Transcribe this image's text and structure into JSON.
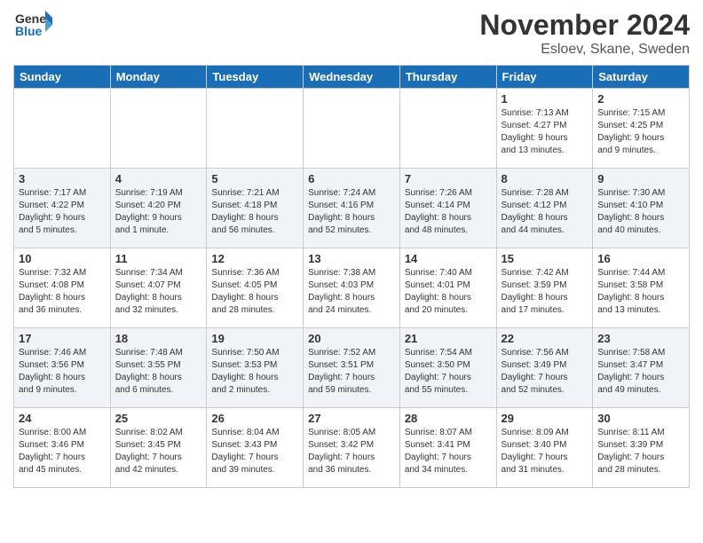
{
  "header": {
    "logo_general": "General",
    "logo_blue": "Blue",
    "month_title": "November 2024",
    "location": "Esloev, Skane, Sweden"
  },
  "weekdays": [
    "Sunday",
    "Monday",
    "Tuesday",
    "Wednesday",
    "Thursday",
    "Friday",
    "Saturday"
  ],
  "weeks": [
    [
      {
        "day": "",
        "info": ""
      },
      {
        "day": "",
        "info": ""
      },
      {
        "day": "",
        "info": ""
      },
      {
        "day": "",
        "info": ""
      },
      {
        "day": "",
        "info": ""
      },
      {
        "day": "1",
        "info": "Sunrise: 7:13 AM\nSunset: 4:27 PM\nDaylight: 9 hours\nand 13 minutes."
      },
      {
        "day": "2",
        "info": "Sunrise: 7:15 AM\nSunset: 4:25 PM\nDaylight: 9 hours\nand 9 minutes."
      }
    ],
    [
      {
        "day": "3",
        "info": "Sunrise: 7:17 AM\nSunset: 4:22 PM\nDaylight: 9 hours\nand 5 minutes."
      },
      {
        "day": "4",
        "info": "Sunrise: 7:19 AM\nSunset: 4:20 PM\nDaylight: 9 hours\nand 1 minute."
      },
      {
        "day": "5",
        "info": "Sunrise: 7:21 AM\nSunset: 4:18 PM\nDaylight: 8 hours\nand 56 minutes."
      },
      {
        "day": "6",
        "info": "Sunrise: 7:24 AM\nSunset: 4:16 PM\nDaylight: 8 hours\nand 52 minutes."
      },
      {
        "day": "7",
        "info": "Sunrise: 7:26 AM\nSunset: 4:14 PM\nDaylight: 8 hours\nand 48 minutes."
      },
      {
        "day": "8",
        "info": "Sunrise: 7:28 AM\nSunset: 4:12 PM\nDaylight: 8 hours\nand 44 minutes."
      },
      {
        "day": "9",
        "info": "Sunrise: 7:30 AM\nSunset: 4:10 PM\nDaylight: 8 hours\nand 40 minutes."
      }
    ],
    [
      {
        "day": "10",
        "info": "Sunrise: 7:32 AM\nSunset: 4:08 PM\nDaylight: 8 hours\nand 36 minutes."
      },
      {
        "day": "11",
        "info": "Sunrise: 7:34 AM\nSunset: 4:07 PM\nDaylight: 8 hours\nand 32 minutes."
      },
      {
        "day": "12",
        "info": "Sunrise: 7:36 AM\nSunset: 4:05 PM\nDaylight: 8 hours\nand 28 minutes."
      },
      {
        "day": "13",
        "info": "Sunrise: 7:38 AM\nSunset: 4:03 PM\nDaylight: 8 hours\nand 24 minutes."
      },
      {
        "day": "14",
        "info": "Sunrise: 7:40 AM\nSunset: 4:01 PM\nDaylight: 8 hours\nand 20 minutes."
      },
      {
        "day": "15",
        "info": "Sunrise: 7:42 AM\nSunset: 3:59 PM\nDaylight: 8 hours\nand 17 minutes."
      },
      {
        "day": "16",
        "info": "Sunrise: 7:44 AM\nSunset: 3:58 PM\nDaylight: 8 hours\nand 13 minutes."
      }
    ],
    [
      {
        "day": "17",
        "info": "Sunrise: 7:46 AM\nSunset: 3:56 PM\nDaylight: 8 hours\nand 9 minutes."
      },
      {
        "day": "18",
        "info": "Sunrise: 7:48 AM\nSunset: 3:55 PM\nDaylight: 8 hours\nand 6 minutes."
      },
      {
        "day": "19",
        "info": "Sunrise: 7:50 AM\nSunset: 3:53 PM\nDaylight: 8 hours\nand 2 minutes."
      },
      {
        "day": "20",
        "info": "Sunrise: 7:52 AM\nSunset: 3:51 PM\nDaylight: 7 hours\nand 59 minutes."
      },
      {
        "day": "21",
        "info": "Sunrise: 7:54 AM\nSunset: 3:50 PM\nDaylight: 7 hours\nand 55 minutes."
      },
      {
        "day": "22",
        "info": "Sunrise: 7:56 AM\nSunset: 3:49 PM\nDaylight: 7 hours\nand 52 minutes."
      },
      {
        "day": "23",
        "info": "Sunrise: 7:58 AM\nSunset: 3:47 PM\nDaylight: 7 hours\nand 49 minutes."
      }
    ],
    [
      {
        "day": "24",
        "info": "Sunrise: 8:00 AM\nSunset: 3:46 PM\nDaylight: 7 hours\nand 45 minutes."
      },
      {
        "day": "25",
        "info": "Sunrise: 8:02 AM\nSunset: 3:45 PM\nDaylight: 7 hours\nand 42 minutes."
      },
      {
        "day": "26",
        "info": "Sunrise: 8:04 AM\nSunset: 3:43 PM\nDaylight: 7 hours\nand 39 minutes."
      },
      {
        "day": "27",
        "info": "Sunrise: 8:05 AM\nSunset: 3:42 PM\nDaylight: 7 hours\nand 36 minutes."
      },
      {
        "day": "28",
        "info": "Sunrise: 8:07 AM\nSunset: 3:41 PM\nDaylight: 7 hours\nand 34 minutes."
      },
      {
        "day": "29",
        "info": "Sunrise: 8:09 AM\nSunset: 3:40 PM\nDaylight: 7 hours\nand 31 minutes."
      },
      {
        "day": "30",
        "info": "Sunrise: 8:11 AM\nSunset: 3:39 PM\nDaylight: 7 hours\nand 28 minutes."
      }
    ]
  ]
}
